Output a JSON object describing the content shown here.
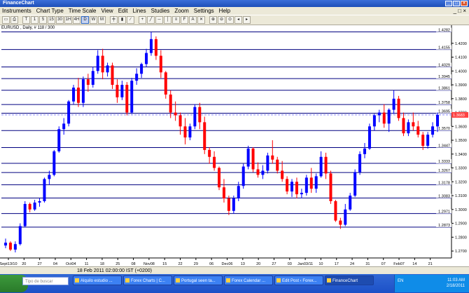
{
  "window": {
    "title": "FinanceChart"
  },
  "menu": {
    "items": [
      "Instruments",
      "Chart Type",
      "Time Scale",
      "View",
      "Edit",
      "Lines",
      "Studies",
      "Zoom",
      "Settings",
      "Help"
    ],
    "right": "_ □ ×"
  },
  "toolbar": {
    "buttons": [
      "T",
      "1",
      "5",
      "15",
      "30",
      "1H",
      "4H",
      "D",
      "W",
      "M"
    ]
  },
  "chart_info": "EURUSD , Daily, # 118 / 300",
  "chart_data": {
    "type": "candlestick",
    "symbol": "EURUSD",
    "ylim": [
      1.265,
      1.43
    ],
    "y_ticks": [
      1.27,
      1.28,
      1.29,
      1.3,
      1.31,
      1.32,
      1.33,
      1.34,
      1.35,
      1.36,
      1.37,
      1.38,
      1.39,
      1.4,
      1.41,
      1.42
    ],
    "h_levels": [
      "1.4282",
      "1.4155",
      "1.4029",
      "1.3945",
      "1.3861",
      "1.3758",
      "1.3695",
      "1.3570",
      "1.3447",
      "1.3333",
      "1.3267",
      "1.3178",
      "1.3083",
      "1.2971",
      "1.2873"
    ],
    "current_price": "1.3683",
    "x_labels": [
      "Sept13/10",
      "20",
      "27",
      "04",
      "Oct04",
      "11",
      "18",
      "25",
      "08",
      "Nov08",
      "15",
      "22",
      "29",
      "06",
      "Dec06",
      "13",
      "20",
      "27",
      "03",
      "Jan03/11",
      "10",
      "17",
      "24",
      "31",
      "07",
      "Feb07",
      "14",
      "21"
    ],
    "candles": [
      [
        1.274,
        1.279,
        1.272,
        1.276
      ],
      [
        1.276,
        1.277,
        1.27,
        1.271
      ],
      [
        1.271,
        1.277,
        1.269,
        1.275
      ],
      [
        1.275,
        1.29,
        1.274,
        1.288
      ],
      [
        1.288,
        1.306,
        1.287,
        1.304
      ],
      [
        1.304,
        1.305,
        1.298,
        1.3
      ],
      [
        1.3,
        1.307,
        1.299,
        1.305
      ],
      [
        1.305,
        1.308,
        1.302,
        1.306
      ],
      [
        1.306,
        1.323,
        1.305,
        1.322
      ],
      [
        1.322,
        1.328,
        1.318,
        1.325
      ],
      [
        1.325,
        1.343,
        1.324,
        1.342
      ],
      [
        1.342,
        1.36,
        1.341,
        1.358
      ],
      [
        1.358,
        1.366,
        1.354,
        1.362
      ],
      [
        1.362,
        1.379,
        1.36,
        1.378
      ],
      [
        1.378,
        1.39,
        1.376,
        1.388
      ],
      [
        1.388,
        1.395,
        1.374,
        1.377
      ],
      [
        1.377,
        1.396,
        1.374,
        1.394
      ],
      [
        1.394,
        1.398,
        1.385,
        1.39
      ],
      [
        1.39,
        1.403,
        1.388,
        1.4
      ],
      [
        1.4,
        1.415,
        1.398,
        1.411
      ],
      [
        1.411,
        1.416,
        1.394,
        1.399
      ],
      [
        1.399,
        1.406,
        1.396,
        1.404
      ],
      [
        1.404,
        1.406,
        1.387,
        1.39
      ],
      [
        1.39,
        1.394,
        1.377,
        1.381
      ],
      [
        1.381,
        1.393,
        1.379,
        1.39
      ],
      [
        1.39,
        1.392,
        1.368,
        1.37
      ],
      [
        1.37,
        1.395,
        1.369,
        1.393
      ],
      [
        1.393,
        1.402,
        1.39,
        1.398
      ],
      [
        1.398,
        1.406,
        1.395,
        1.405
      ],
      [
        1.405,
        1.416,
        1.403,
        1.413
      ],
      [
        1.413,
        1.428,
        1.411,
        1.423
      ],
      [
        1.423,
        1.425,
        1.408,
        1.411
      ],
      [
        1.411,
        1.415,
        1.395,
        1.399
      ],
      [
        1.399,
        1.4,
        1.38,
        1.383
      ],
      [
        1.383,
        1.386,
        1.366,
        1.37
      ],
      [
        1.37,
        1.378,
        1.364,
        1.368
      ],
      [
        1.368,
        1.37,
        1.354,
        1.36
      ],
      [
        1.36,
        1.366,
        1.347,
        1.352
      ],
      [
        1.352,
        1.362,
        1.35,
        1.36
      ],
      [
        1.36,
        1.376,
        1.358,
        1.374
      ],
      [
        1.374,
        1.377,
        1.358,
        1.363
      ],
      [
        1.363,
        1.367,
        1.34,
        1.343
      ],
      [
        1.343,
        1.345,
        1.333,
        1.338
      ],
      [
        1.338,
        1.342,
        1.328,
        1.33
      ],
      [
        1.33,
        1.331,
        1.314,
        1.316
      ],
      [
        1.316,
        1.322,
        1.305,
        1.308
      ],
      [
        1.308,
        1.31,
        1.296,
        1.299
      ],
      [
        1.299,
        1.31,
        1.297,
        1.308
      ],
      [
        1.308,
        1.32,
        1.306,
        1.317
      ],
      [
        1.317,
        1.333,
        1.315,
        1.331
      ],
      [
        1.331,
        1.346,
        1.329,
        1.344
      ],
      [
        1.344,
        1.345,
        1.327,
        1.329
      ],
      [
        1.329,
        1.334,
        1.323,
        1.325
      ],
      [
        1.325,
        1.332,
        1.322,
        1.328
      ],
      [
        1.328,
        1.341,
        1.326,
        1.339
      ],
      [
        1.339,
        1.35,
        1.333,
        1.336
      ],
      [
        1.336,
        1.338,
        1.326,
        1.328
      ],
      [
        1.328,
        1.335,
        1.32,
        1.322
      ],
      [
        1.322,
        1.324,
        1.311,
        1.313
      ],
      [
        1.313,
        1.322,
        1.309,
        1.32
      ],
      [
        1.32,
        1.323,
        1.308,
        1.311
      ],
      [
        1.311,
        1.315,
        1.308,
        1.312
      ],
      [
        1.312,
        1.325,
        1.31,
        1.323
      ],
      [
        1.323,
        1.33,
        1.312,
        1.315
      ],
      [
        1.315,
        1.326,
        1.312,
        1.324
      ],
      [
        1.324,
        1.342,
        1.323,
        1.338
      ],
      [
        1.338,
        1.341,
        1.322,
        1.326
      ],
      [
        1.326,
        1.328,
        1.304,
        1.306
      ],
      [
        1.306,
        1.307,
        1.291,
        1.292
      ],
      [
        1.292,
        1.294,
        1.286,
        1.289
      ],
      [
        1.289,
        1.304,
        1.288,
        1.3
      ],
      [
        1.3,
        1.312,
        1.299,
        1.31
      ],
      [
        1.31,
        1.329,
        1.309,
        1.327
      ],
      [
        1.327,
        1.342,
        1.325,
        1.34
      ],
      [
        1.34,
        1.348,
        1.337,
        1.344
      ],
      [
        1.344,
        1.362,
        1.343,
        1.36
      ],
      [
        1.36,
        1.369,
        1.357,
        1.368
      ],
      [
        1.368,
        1.372,
        1.363,
        1.37
      ],
      [
        1.37,
        1.376,
        1.359,
        1.362
      ],
      [
        1.362,
        1.373,
        1.356,
        1.372
      ],
      [
        1.372,
        1.386,
        1.369,
        1.38
      ],
      [
        1.38,
        1.382,
        1.364,
        1.366
      ],
      [
        1.366,
        1.37,
        1.353,
        1.355
      ],
      [
        1.355,
        1.365,
        1.353,
        1.363
      ],
      [
        1.363,
        1.37,
        1.357,
        1.36
      ],
      [
        1.36,
        1.364,
        1.352,
        1.354
      ],
      [
        1.354,
        1.356,
        1.343,
        1.346
      ],
      [
        1.346,
        1.356,
        1.344,
        1.354
      ],
      [
        1.354,
        1.363,
        1.352,
        1.36
      ],
      [
        1.36,
        1.37,
        1.356,
        1.3683
      ]
    ]
  },
  "status": {
    "left": "",
    "datetime": "18 Feb 2011 02:00:00  IST (+0200)"
  },
  "taskbar": {
    "search_placeholder": "Tipo de buscar",
    "tasks": [
      "Alquilo estudio ...",
      "Forex Charts | C...",
      "Portugal seen ta...",
      "Forex Calendar ...",
      "Edit Post ‹ Forex...",
      "FinanceChart"
    ],
    "lang": "EN",
    "time": "11:03 AM",
    "date": "2/18/2011"
  },
  "colors": {
    "bull": "#0000ff",
    "bear": "#ff0000",
    "grid": "#000080",
    "current_line": "#8080ff",
    "price_box": "#ff4040"
  }
}
